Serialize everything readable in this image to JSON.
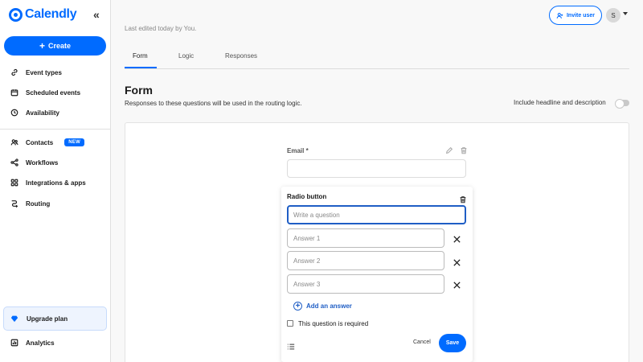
{
  "app": {
    "name": "Calendly",
    "brand_color": "#006bff"
  },
  "sidebar": {
    "create_label": "Create",
    "items": [
      {
        "label": "Event types",
        "icon": "link-icon"
      },
      {
        "label": "Scheduled events",
        "icon": "calendar-icon"
      },
      {
        "label": "Availability",
        "icon": "clock-icon"
      },
      {
        "label": "Contacts",
        "icon": "contacts-icon",
        "badge": "NEW"
      },
      {
        "label": "Workflows",
        "icon": "share-nodes-icon"
      },
      {
        "label": "Integrations & apps",
        "icon": "grid-icon"
      },
      {
        "label": "Routing",
        "icon": "routing-icon"
      },
      {
        "label": "Upgrade plan",
        "icon": "diamond-icon"
      },
      {
        "label": "Analytics",
        "icon": "bar-chart-icon"
      }
    ]
  },
  "header": {
    "edited_text": "Last edited today by You.",
    "invite_label": "Invite user",
    "avatar_initial": "S"
  },
  "tabs": [
    {
      "label": "Form",
      "active": true
    },
    {
      "label": "Logic",
      "active": false
    },
    {
      "label": "Responses",
      "active": false
    }
  ],
  "form": {
    "title": "Form",
    "description": "Responses to these questions will be used in the routing logic.",
    "headline_toggle_label": "Include headline and description",
    "headline_toggle_on": false,
    "email_label": "Email *",
    "radio": {
      "title": "Radio button",
      "question_placeholder": "Write a question",
      "answers": [
        "Answer 1",
        "Answer 2",
        "Answer 3"
      ],
      "add_answer_label": "Add an answer",
      "required_label": "This question is required",
      "required_checked": false,
      "cancel_label": "Cancel",
      "save_label": "Save"
    }
  }
}
